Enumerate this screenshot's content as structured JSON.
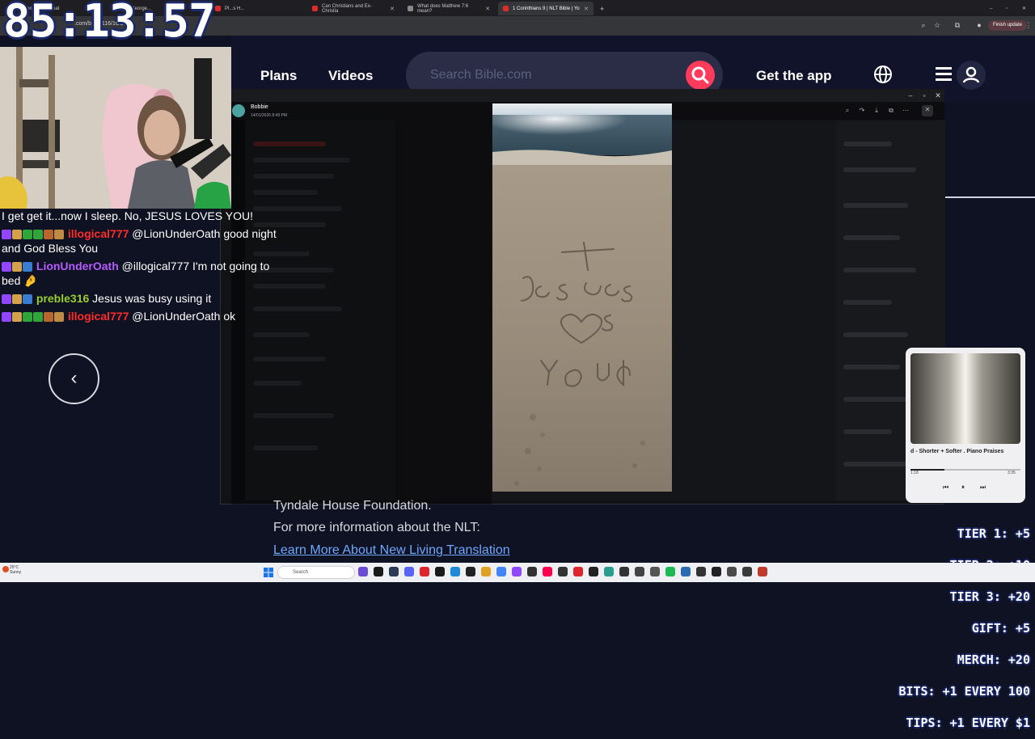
{
  "browser": {
    "tabs": [
      {
        "label": "Stream...he Ultimat",
        "active": false
      },
      {
        "label": "George...",
        "active": false
      },
      {
        "label": "Pl...s H...",
        "active": false
      },
      {
        "label": "Can Christians and Ex-Christia",
        "active": false
      },
      {
        "label": "What does Matthew 7:6 mean?",
        "active": false
      },
      {
        "label": "1 Corinthians 9 | NLT Bible | Yo",
        "active": true
      }
    ],
    "new_tab": "+",
    "url": ".com/bible/116/1CO.9",
    "finish_update": "Finish update"
  },
  "overlay": {
    "clock": "85:13:57",
    "tiers": [
      "TIER 1: +5",
      "TIER 2: +10",
      "TIER 3: +20",
      "GIFT: +5",
      "MERCH: +20",
      "BITS: +1 EVERY 100",
      "TIPS: +1 EVERY $1"
    ]
  },
  "site": {
    "nav": {
      "plans": "Plans",
      "videos": "Videos",
      "get_app": "Get the app"
    },
    "search_placeholder": "Search Bible.com",
    "footer_line1": "Tyndale House Foundation.",
    "footer_line2": "For more information about the NLT:",
    "footer_link": "Learn More About New Living Translation"
  },
  "chat": [
    {
      "user": "",
      "user_class": "",
      "message": "I get get it...now I sleep. No, JESUS LOVES YOU!"
    },
    {
      "user": "illogical777",
      "user_class": "user-red",
      "message": " @LionUnderOath good night and God Bless You"
    },
    {
      "user": "LionUnderOath",
      "user_class": "user-purple",
      "message": " @illogical777 I'm not going to bed 🤌"
    },
    {
      "user": "preble316",
      "user_class": "user-green",
      "message": " Jesus was busy using it"
    },
    {
      "user": "illogical777",
      "user_class": "user-red",
      "message": " @LionUnderOath ok"
    }
  ],
  "discord": {
    "sender": "Bobbie",
    "time": "14/01/2026 8:49 PM"
  },
  "music": {
    "title": "d - Shorter + Softer . Piano Praises",
    "elapsed": "1:18",
    "total": "3:35",
    "progress": 0.31
  },
  "taskbar": {
    "weather_temp": "25°C",
    "weather_desc": "Sunny",
    "search": "Search"
  },
  "colors": {
    "accent": "#ff3b5c",
    "link": "#6ea8ff",
    "page_bg": "#0f1222"
  }
}
